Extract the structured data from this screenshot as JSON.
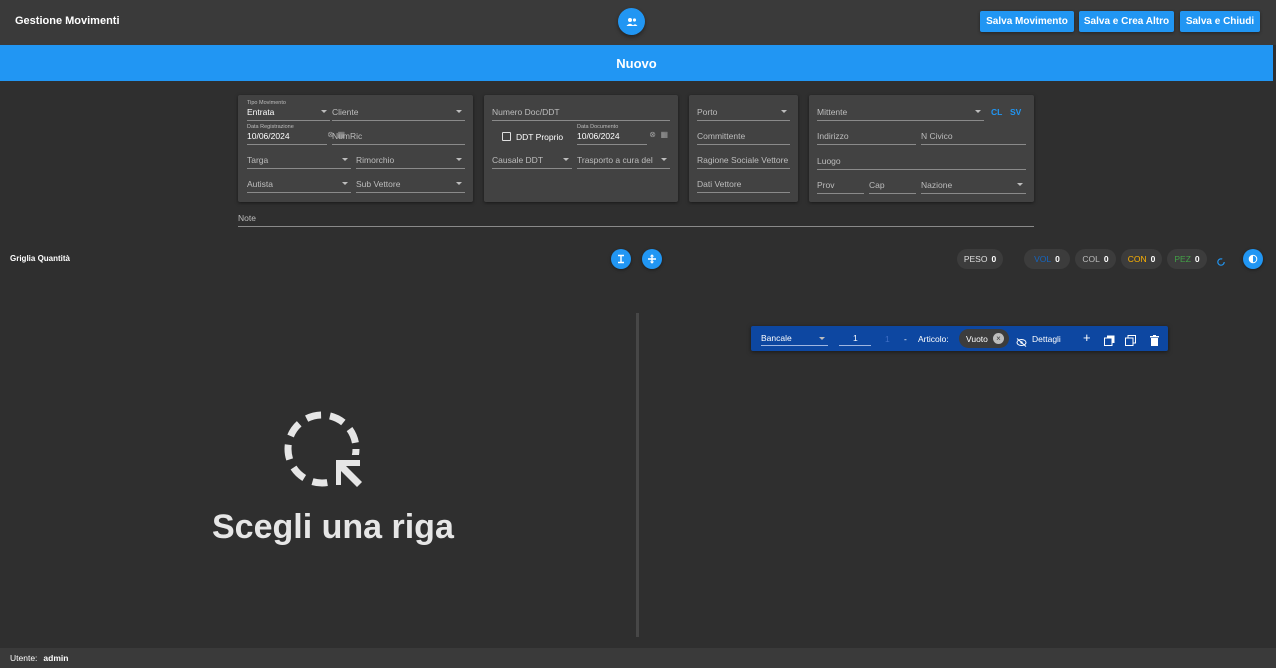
{
  "header": {
    "title": "Gestione Movimenti",
    "center_icon": "people-icon",
    "buttons": [
      "Salva Movimento",
      "Salva e Crea Altro",
      "Salva e Chiudi"
    ]
  },
  "banner": {
    "title": "Nuovo"
  },
  "form": {
    "tipo_movimento": {
      "label": "Tipo Movimento",
      "value": "Entrata"
    },
    "cliente": {
      "label": "Cliente"
    },
    "data_registrazione": {
      "label": "Data Registrazione",
      "value": "10/06/2024"
    },
    "numric": {
      "label": "NumRic"
    },
    "targa": {
      "label": "Targa"
    },
    "rimorchio": {
      "label": "Rimorchio"
    },
    "autista": {
      "label": "Autista"
    },
    "sub_vettore": {
      "label": "Sub Vettore"
    },
    "numero_doc": {
      "label": "Numero Doc/DDT"
    },
    "ddt_proprio": {
      "label": "DDT Proprio",
      "checked": false
    },
    "data_documento": {
      "label": "Data Documento",
      "value": "10/06/2024"
    },
    "causale_ddt": {
      "label": "Causale DDT"
    },
    "trasporto": {
      "label": "Trasporto a cura del"
    },
    "porto": {
      "label": "Porto"
    },
    "committente": {
      "label": "Committente"
    },
    "ragione_sociale": {
      "label": "Ragione Sociale Vettore"
    },
    "dati_vettore": {
      "label": "Dati Vettore"
    },
    "mittente": {
      "label": "Mittente",
      "cl": "CL",
      "sv": "SV"
    },
    "indirizzo": {
      "label": "Indirizzo"
    },
    "n_civico": {
      "label": "N Civico"
    },
    "luogo": {
      "label": "Luogo"
    },
    "prov": {
      "label": "Prov"
    },
    "cap": {
      "label": "Cap"
    },
    "nazione": {
      "label": "Nazione"
    },
    "note": {
      "label": "Note"
    }
  },
  "grid": {
    "title": "Griglia Quantità",
    "chips": [
      {
        "label": "PESO",
        "value": "0",
        "color": "#e0e0e0"
      },
      {
        "label": "VOL",
        "value": "0",
        "color": "#1565c0"
      },
      {
        "label": "COL",
        "value": "0",
        "color": "#bdbdbd"
      },
      {
        "label": "CON",
        "value": "0",
        "color": "#ffb300"
      },
      {
        "label": "PEZ",
        "value": "0",
        "color": "#43a047"
      }
    ]
  },
  "row_toolbar": {
    "type": "Bancale",
    "quantity": "1",
    "index": "1",
    "dash": "-",
    "articolo_label": "Articolo:",
    "articolo_value": "Vuoto",
    "details_label": "Dettagli"
  },
  "empty_state": {
    "text": "Scegli una riga"
  },
  "footer": {
    "user_label": "Utente:",
    "user": "admin"
  },
  "colors": {
    "accent": "#2196f3",
    "panel": "#0d47a1",
    "background": "#2f2f2f"
  }
}
